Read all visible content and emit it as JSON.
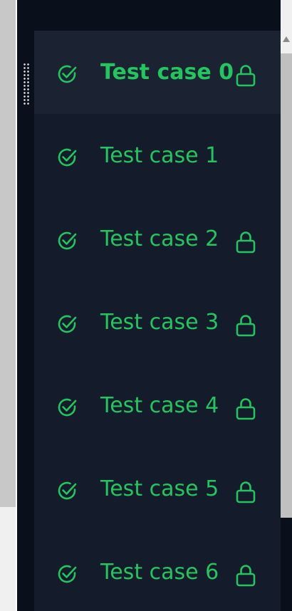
{
  "colors": {
    "accent": "#22c55e",
    "panel_bg": "#0a0f1c",
    "list_bg": "#141b2a",
    "active_row_bg": "#1b2231"
  },
  "test_cases": [
    {
      "label": "Test case 0",
      "status": "passed",
      "locked": true,
      "selected": true
    },
    {
      "label": "Test case 1",
      "status": "passed",
      "locked": false,
      "selected": false
    },
    {
      "label": "Test case 2",
      "status": "passed",
      "locked": true,
      "selected": false
    },
    {
      "label": "Test case 3",
      "status": "passed",
      "locked": true,
      "selected": false
    },
    {
      "label": "Test case 4",
      "status": "passed",
      "locked": true,
      "selected": false
    },
    {
      "label": "Test case 5",
      "status": "passed",
      "locked": true,
      "selected": false
    },
    {
      "label": "Test case 6",
      "status": "passed",
      "locked": true,
      "selected": false
    }
  ],
  "icons": {
    "status": "check-circle-icon",
    "lock": "lock-icon",
    "drag": "drag-handle-icon"
  }
}
